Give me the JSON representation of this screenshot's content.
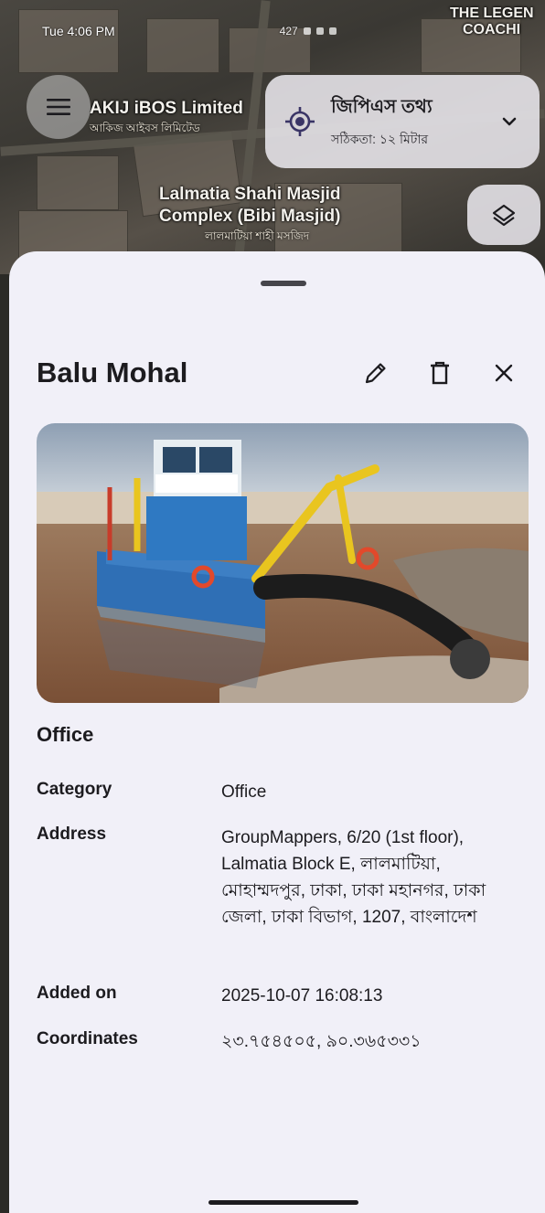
{
  "status_bar": {
    "time": "Tue 4:06 PM",
    "right_text": "427"
  },
  "map": {
    "labels": [
      "AKIJ iBOS Limited",
      "আকিজ আইবস লিমিটেড",
      "Lalmatia Shahi Masjid",
      "Complex (Bibi Masjid)",
      "লালমাটিয়া শাহী মসজিদ",
      "THE LEGEN",
      "COACHI"
    ]
  },
  "gps_card": {
    "title": "জিপিএস তথ্য",
    "accuracy": "সঠিকতা: ১২ মিটার"
  },
  "sheet": {
    "title": "Balu Mohal",
    "type_label": "Office",
    "details": [
      {
        "key": "Category",
        "value": "Office"
      },
      {
        "key": "Address",
        "value": "GroupMappers, 6/20 (1st floor), Lalmatia Block E, লালমাটিয়া, মোহাম্মদপুর, ঢাকা, ঢাকা মহানগর, ঢাকা জেলা, ঢাকা বিভাগ, 1207, বাংলাদেশ"
      },
      {
        "key": "Added on",
        "value": "2025-10-07 16:08:13"
      },
      {
        "key": "Coordinates",
        "value": "২৩.৭৫৪৫০৫, ৯০.৩৬৫৩৩১"
      }
    ]
  },
  "colors": {
    "sheet_bg": "#f1f0f8",
    "gps_icon": "#3a3566",
    "text": "#1c1b1f"
  },
  "icons": {
    "menu": "menu-icon",
    "gps": "gps-target-icon",
    "chevron": "chevron-down-icon",
    "layers": "layers-icon",
    "edit": "pencil-icon",
    "delete": "trash-icon",
    "close": "close-icon"
  }
}
